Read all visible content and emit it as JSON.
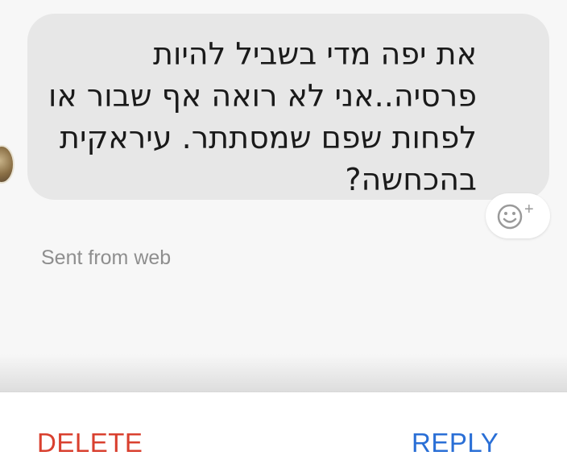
{
  "message": {
    "lines": [
      "את יפה מדי בשביל להיות",
      "פרסיה..אני לא רואה אף שבור או",
      "לפחות שפם שמסתתר. עיראקית",
      "בהכחשה?"
    ],
    "react_icon": "emoji-add-icon",
    "react_plus": "+"
  },
  "meta": {
    "sent_from": "Sent from web"
  },
  "actions": {
    "delete_label": "DELETE",
    "reply_label": "REPLY"
  },
  "colors": {
    "delete": "#d9402f",
    "reply": "#2a6fd6",
    "bubble": "#e7e7e7"
  }
}
